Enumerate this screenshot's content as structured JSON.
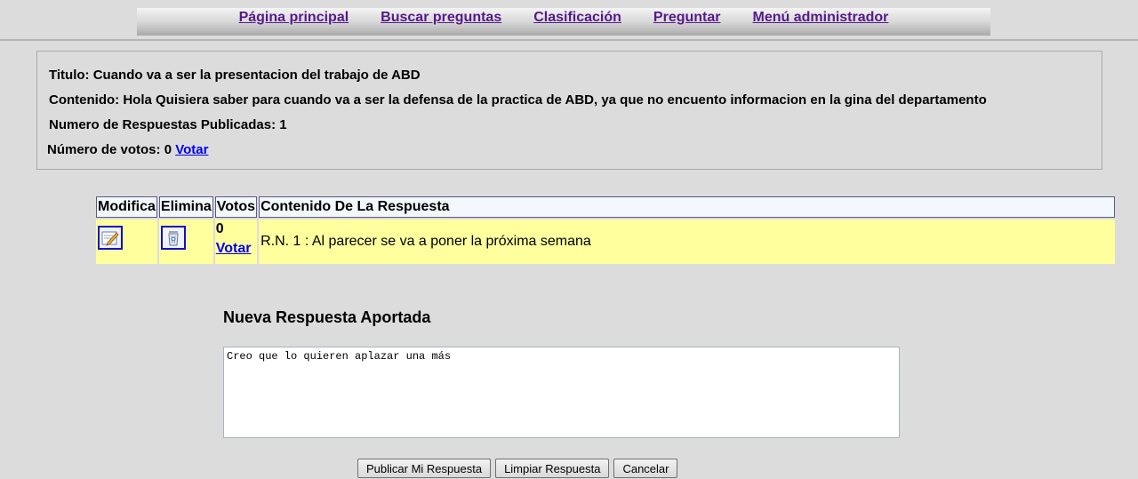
{
  "nav": {
    "items": [
      {
        "label": "Página principal"
      },
      {
        "label": "Buscar preguntas"
      },
      {
        "label": "Clasificación"
      },
      {
        "label": "Preguntar"
      },
      {
        "label": "Menú administrador"
      }
    ]
  },
  "question": {
    "title_label": "Titulo:",
    "title": "Cuando va a ser la presentacion del trabajo de ABD",
    "content_label": "Contenido:",
    "content": "Hola Quisiera saber para cuando va a ser la defensa de la practica de ABD, ya que no encuento informacion en la gina del departamento",
    "answers_label": "Numero de Respuestas Publicadas:",
    "answers_count": "1",
    "votes_label": "Número de votos:",
    "votes_count": "0",
    "vote_link": "Votar"
  },
  "responses": {
    "headers": {
      "modify": "Modifica",
      "delete": "Elimina",
      "votes": "Votos",
      "content": "Contenido De La Respuesta"
    },
    "rows": [
      {
        "votes": "0",
        "vote_link": "Votar",
        "content": "R.N. 1 : Al parecer se va a poner la próxima semana"
      }
    ]
  },
  "new_response": {
    "title": "Nueva Respuesta Aportada",
    "text": "Creo que lo quieren aplazar una más"
  },
  "buttons": {
    "publish": "Publicar Mi Respuesta",
    "clear": "Limpiar Respuesta",
    "cancel": "Cancelar"
  },
  "colors": {
    "background": "#dcdcdc",
    "row_highlight": "#ffff9e",
    "link": "#0000ee",
    "visited_link": "#551a8b"
  }
}
